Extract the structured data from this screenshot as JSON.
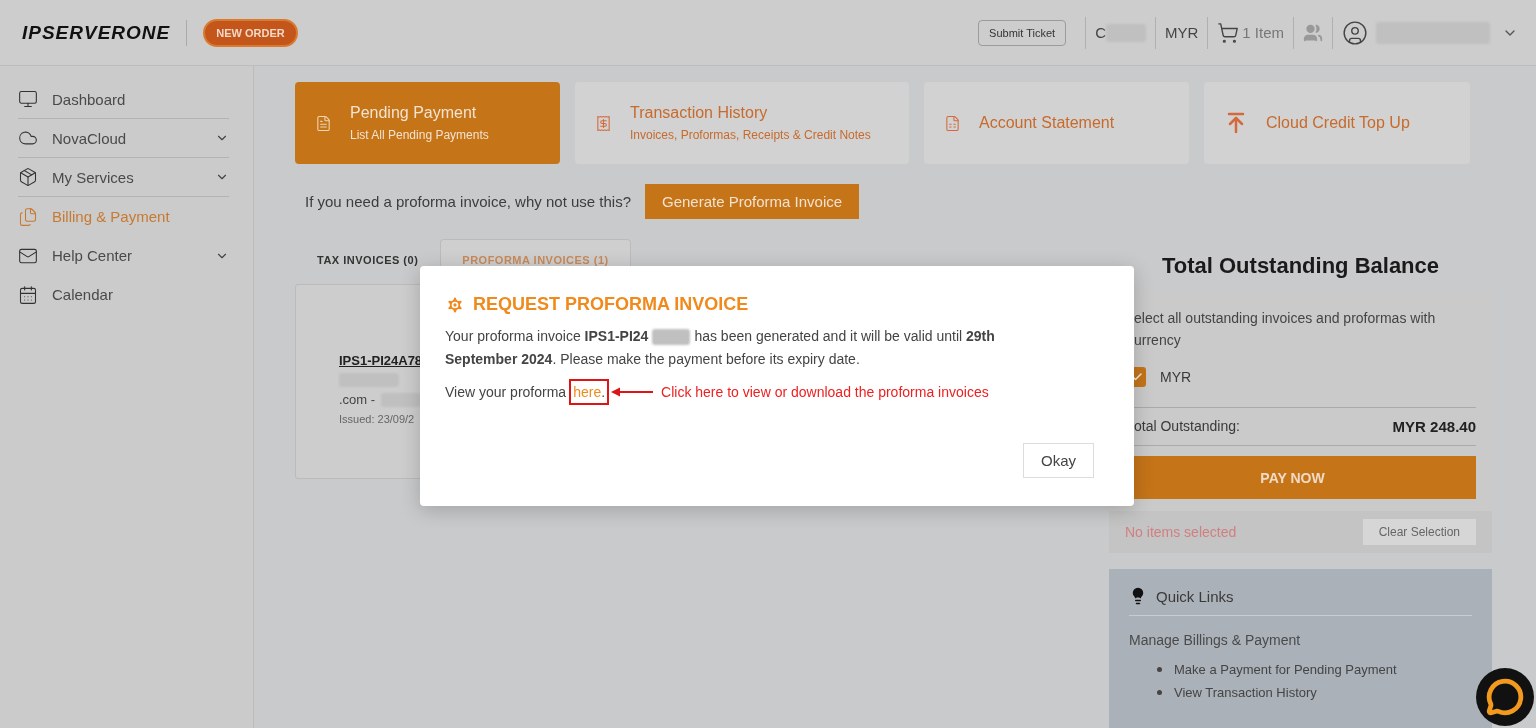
{
  "header": {
    "logo": "IPSERVERONE",
    "new_order": "NEW ORDER",
    "submit_ticket": "Submit Ticket",
    "account_initial": "C",
    "currency": "MYR",
    "cart": "1 Item"
  },
  "sidebar": {
    "items": [
      {
        "label": "Dashboard",
        "selected": false,
        "expandable": false
      },
      {
        "label": "NovaCloud",
        "selected": false,
        "expandable": true
      },
      {
        "label": "My Services",
        "selected": false,
        "expandable": true
      },
      {
        "label": "Billing & Payment",
        "selected": true,
        "expandable": false
      },
      {
        "label": "Help Center",
        "selected": false,
        "expandable": true
      },
      {
        "label": "Calendar",
        "selected": false,
        "expandable": false
      }
    ]
  },
  "cards": [
    {
      "title": "Pending Payment",
      "subtitle": "List All Pending Payments",
      "selected": true
    },
    {
      "title": "Transaction History",
      "subtitle": "Invoices, Proformas, Receipts & Credit Notes",
      "selected": false
    },
    {
      "title": "Account Statement",
      "selected": false
    },
    {
      "title": "Cloud Credit Top Up",
      "selected": false
    }
  ],
  "proforma_prompt": {
    "text": "If you need a proforma invoice, why not use this?",
    "button": "Generate Proforma Invoice"
  },
  "tabs": [
    {
      "label": "TAX INVOICES (0)",
      "selected": false
    },
    {
      "label": "PROFORMA INVOICES (1)",
      "selected": true
    }
  ],
  "invoice": {
    "number": "IPS1-PI24A78",
    "line_2": ".com -",
    "issued": "Issued: 23/09/2"
  },
  "balance": {
    "title": "Total Outstanding Balance",
    "description": "elect all outstanding invoices and proformas with",
    "description_2": "urrency",
    "currency_option": {
      "label": "MYR",
      "checked": true
    },
    "total_label": "otal Outstanding:",
    "total_value": "MYR 248.40",
    "pay_button": "PAY NOW",
    "status": "No items selected",
    "clear_button": "Clear Selection"
  },
  "quick_links": {
    "title": "Quick Links",
    "subtitle": "Manage Billings & Payment",
    "links": [
      "Make a Payment for Pending Payment",
      "View Transaction History"
    ]
  },
  "modal": {
    "title": "REQUEST PROFORMA INVOICE",
    "message_start": "Your proforma invoice **IPS1-PI24**",
    "message_end": "has been generated and it will be valid until **29th**",
    "message_line_2": "**September 2024**. Please make the payment before its expiry date.",
    "view_text": "View your proforma",
    "link": "here",
    "after_link": ".",
    "callout": "Click here to view or download the proforma invoices",
    "button": "Okay"
  }
}
